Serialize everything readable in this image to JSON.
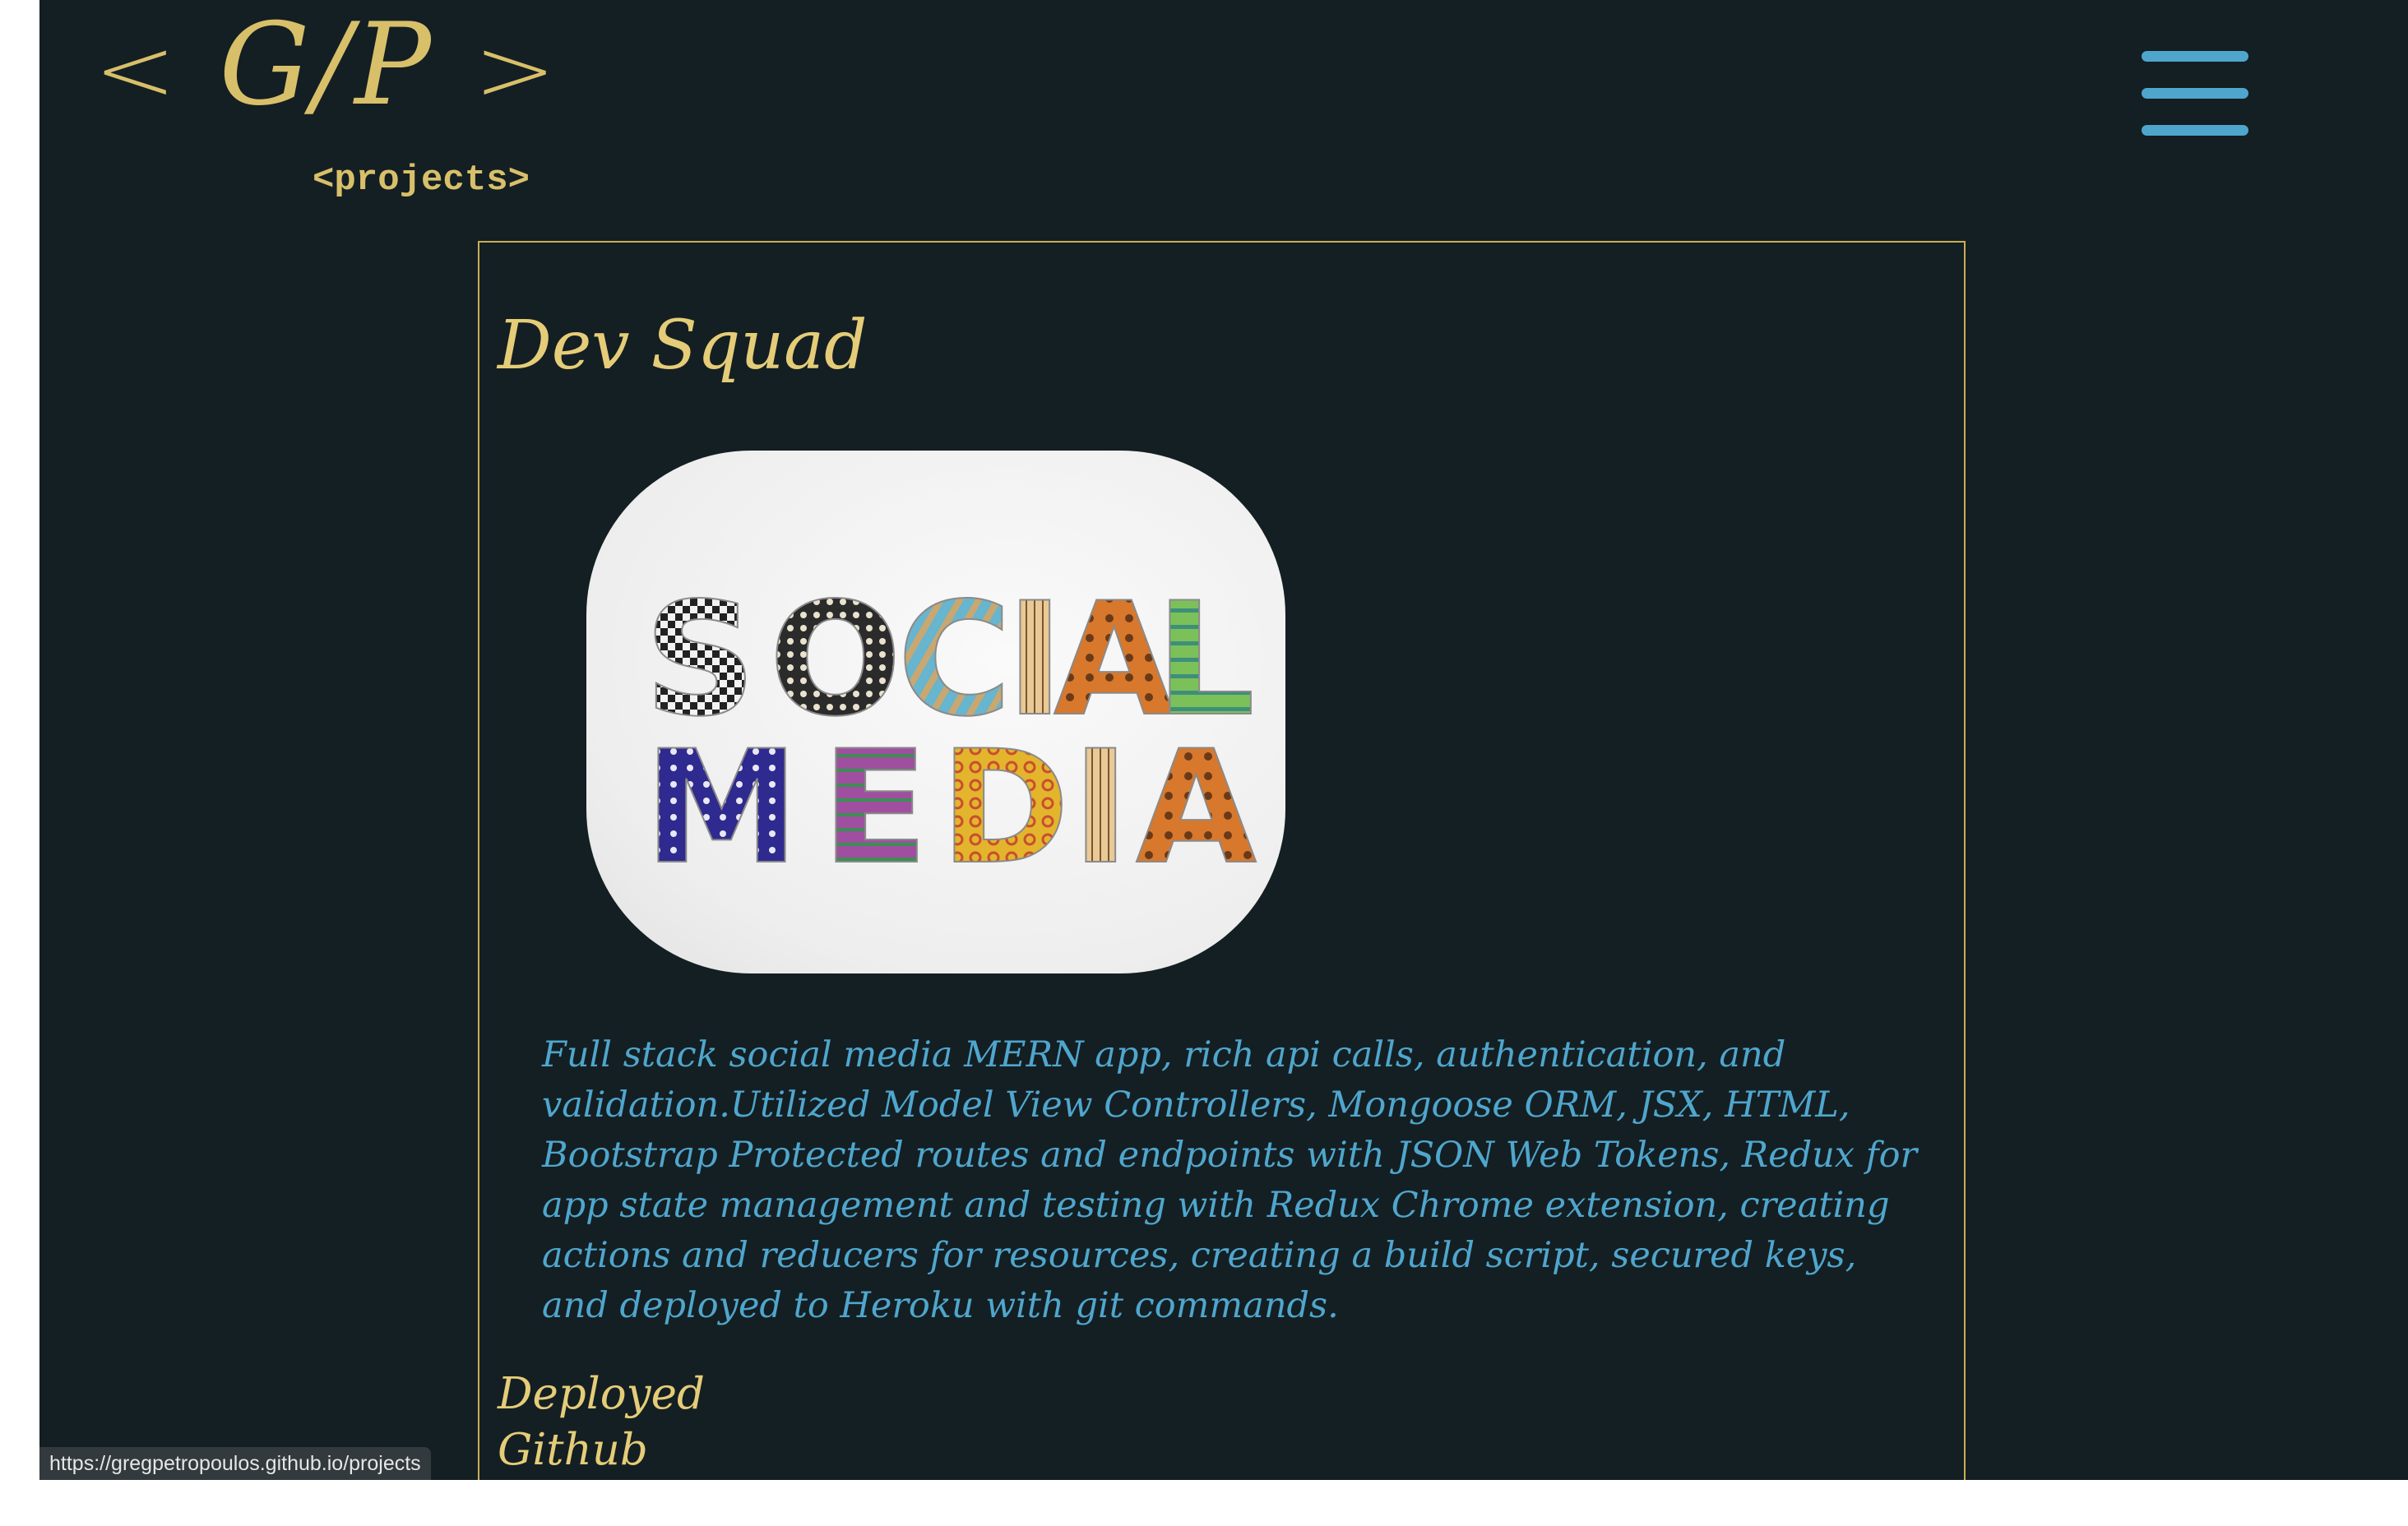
{
  "header": {
    "logo_left_bracket": "<",
    "logo_initials": "G/P",
    "logo_right_bracket": ">",
    "section_tag": "<projects>"
  },
  "menu": {
    "icon": "hamburger-menu-icon",
    "color": "#4fa6cd"
  },
  "project": {
    "title": "Dev Squad",
    "image_text": [
      "SOCIAL",
      "MEDIA"
    ],
    "description": "Full stack social media MERN app, rich api calls, authentication, and validation.Utilized Model View Controllers, Mongoose ORM, JSX, HTML, Bootstrap Protected routes and endpoints with JSON Web Tokens, Redux for app state management and testing with Redux Chrome extension, creating actions and reducers for resources, creating a build script, secured keys, and deployed to Heroku with git commands.",
    "links": {
      "deployed": "Deployed",
      "github": "Github"
    }
  },
  "status_bar": {
    "url": "https://gregpetropoulos.github.io/projects"
  },
  "colors": {
    "background": "#141f23",
    "gold": "#d8bf6a",
    "blue": "#4fa6cd",
    "card_border": "#c8ad55"
  }
}
